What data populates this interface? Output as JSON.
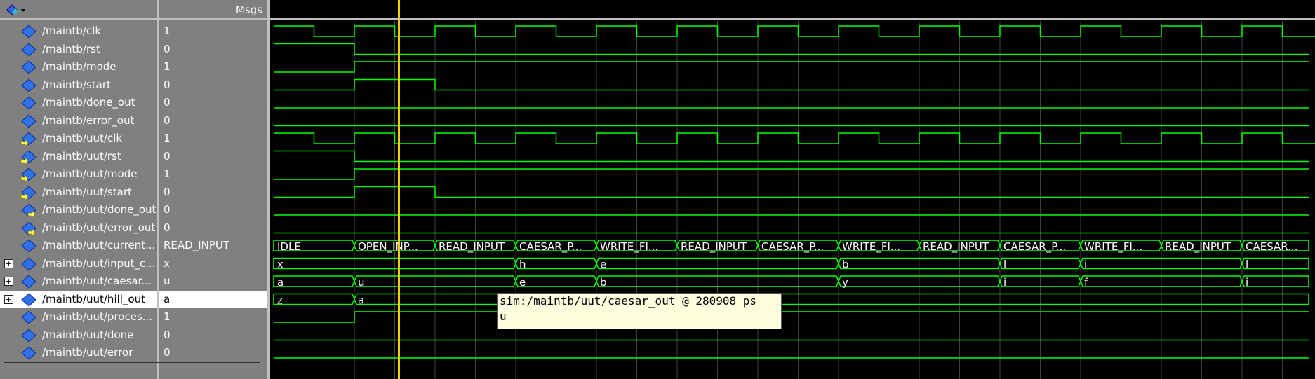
{
  "header": {
    "msgs_label": "Msgs"
  },
  "colors": {
    "panel": "#808080",
    "wave": "#00ff00",
    "grid": "#404040",
    "cursor": "#ffcc00",
    "bus_text": "#ffffff"
  },
  "signals": [
    {
      "name": "/maintb/clk",
      "value": "1",
      "icon": "input-signal-icon",
      "expandable": false
    },
    {
      "name": "/maintb/rst",
      "value": "0",
      "icon": "input-signal-icon",
      "expandable": false
    },
    {
      "name": "/maintb/mode",
      "value": "1",
      "icon": "input-signal-icon",
      "expandable": false
    },
    {
      "name": "/maintb/start",
      "value": "0",
      "icon": "input-signal-icon",
      "expandable": false
    },
    {
      "name": "/maintb/done_out",
      "value": "0",
      "icon": "input-signal-icon",
      "expandable": false
    },
    {
      "name": "/maintb/error_out",
      "value": "0",
      "icon": "input-signal-icon",
      "expandable": false
    },
    {
      "name": "/maintb/uut/clk",
      "value": "1",
      "icon": "port-in-icon",
      "expandable": false
    },
    {
      "name": "/maintb/uut/rst",
      "value": "0",
      "icon": "port-in-icon",
      "expandable": false
    },
    {
      "name": "/maintb/uut/mode",
      "value": "1",
      "icon": "port-in-icon",
      "expandable": false
    },
    {
      "name": "/maintb/uut/start",
      "value": "0",
      "icon": "port-in-icon",
      "expandable": false
    },
    {
      "name": "/maintb/uut/done_out",
      "value": "0",
      "icon": "port-out-icon",
      "expandable": false
    },
    {
      "name": "/maintb/uut/error_out",
      "value": "0",
      "icon": "port-out-icon",
      "expandable": false
    },
    {
      "name": "/maintb/uut/current...",
      "value": "READ_INPUT",
      "icon": "signal-icon",
      "expandable": false
    },
    {
      "name": "/maintb/uut/input_c...",
      "value": "x",
      "icon": "signal-icon",
      "expandable": true
    },
    {
      "name": "/maintb/uut/caesar...",
      "value": "u",
      "icon": "signal-icon",
      "expandable": true
    },
    {
      "name": "/maintb/uut/hill_out",
      "value": "a",
      "icon": "signal-icon",
      "expandable": true,
      "selected": true
    },
    {
      "name": "/maintb/uut/proces...",
      "value": "1",
      "icon": "signal-icon",
      "expandable": false
    },
    {
      "name": "/maintb/uut/done",
      "value": "0",
      "icon": "signal-icon",
      "expandable": false
    },
    {
      "name": "/maintb/uut/error",
      "value": "0",
      "icon": "signal-icon",
      "expandable": false
    }
  ],
  "bus_segments": {
    "current": [
      "IDLE",
      "OPEN_INP...",
      "READ_INPUT",
      "CAESAR_P...",
      "WRITE_FI...",
      "READ_INPUT",
      "CAESAR_P...",
      "WRITE_FI...",
      "READ_INPUT",
      "CAESAR_P...",
      "WRITE_FI...",
      "READ_INPUT",
      "CAESAR..."
    ],
    "input_c": [
      "x",
      "h",
      "e",
      "b",
      "l",
      "i",
      "l"
    ],
    "caesar": [
      "a",
      "u",
      "e",
      "b",
      "y",
      "i",
      "f",
      "i"
    ],
    "hill": [
      "z",
      "a"
    ]
  },
  "tooltip": {
    "line1": "sim:/maintb/uut/caesar_out @ 280908 ps",
    "line2": "u"
  }
}
